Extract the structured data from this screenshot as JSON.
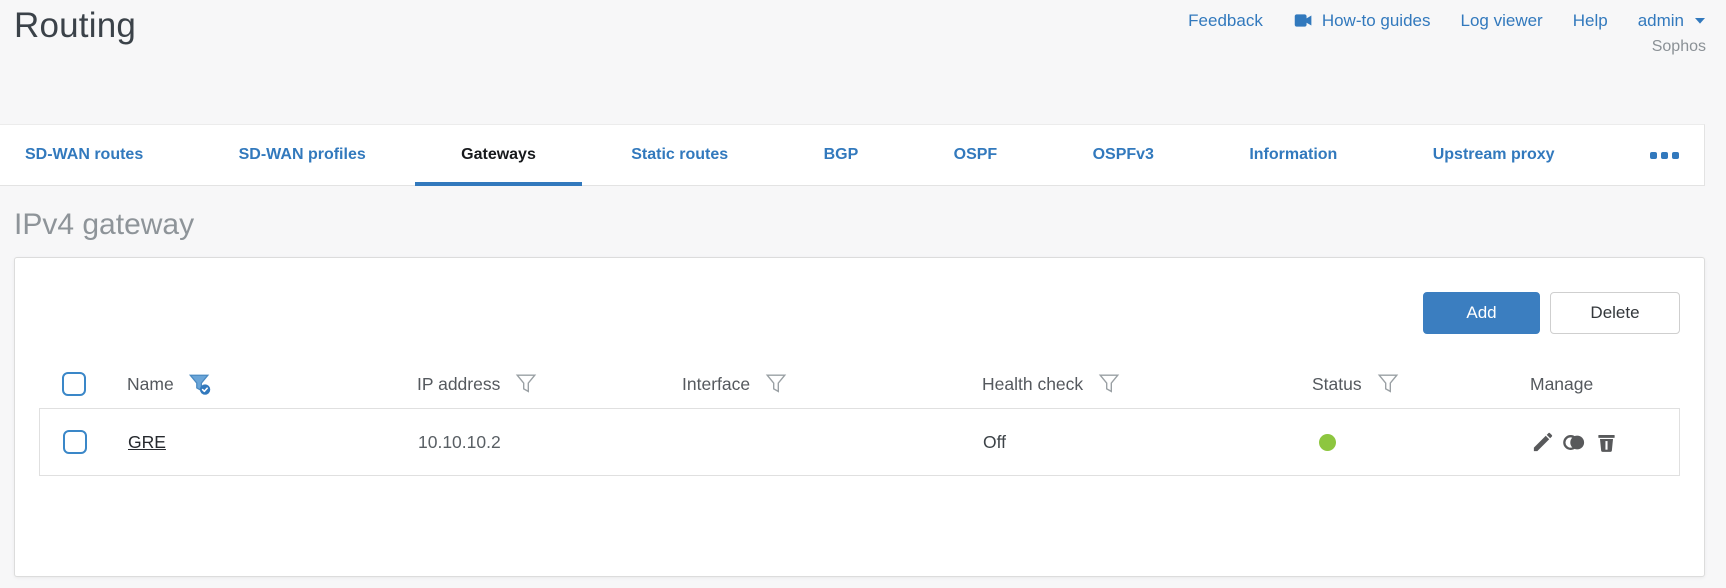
{
  "header": {
    "title": "Routing",
    "links": [
      {
        "label": "Feedback"
      },
      {
        "label": "How-to guides",
        "icon": "video-camera-icon"
      },
      {
        "label": "Log viewer"
      },
      {
        "label": "Help"
      },
      {
        "label": "admin",
        "icon": "caret-down-icon"
      }
    ],
    "account_label": "Sophos"
  },
  "tabs": [
    {
      "label": "SD-WAN routes",
      "active": false
    },
    {
      "label": "SD-WAN profiles",
      "active": false
    },
    {
      "label": "Gateways",
      "active": true
    },
    {
      "label": "Static routes",
      "active": false
    },
    {
      "label": "BGP",
      "active": false
    },
    {
      "label": "OSPF",
      "active": false
    },
    {
      "label": "OSPFv3",
      "active": false
    },
    {
      "label": "Information",
      "active": false
    },
    {
      "label": "Upstream proxy",
      "active": false
    },
    {
      "label": "",
      "icon": "more-tabs-icon"
    }
  ],
  "section": {
    "heading": "IPv4 gateway"
  },
  "toolbar": {
    "add_label": "Add",
    "delete_label": "Delete"
  },
  "table": {
    "columns": [
      {
        "label": "Name",
        "filter": "active"
      },
      {
        "label": "IP address",
        "filter": "inactive"
      },
      {
        "label": "Interface",
        "filter": "inactive"
      },
      {
        "label": "Health check",
        "filter": "inactive"
      },
      {
        "label": "Status",
        "filter": "inactive"
      },
      {
        "label": "Manage",
        "filter": "none"
      }
    ],
    "rows": [
      {
        "name": "GRE",
        "ip_address": "10.10.10.2",
        "interface": "",
        "health_check": "Off",
        "status": "up",
        "manage_actions": [
          "edit",
          "clone",
          "delete"
        ]
      }
    ]
  },
  "colors": {
    "accent_blue": "#3279bd",
    "active_tab_text": "#17191c",
    "status_up_green": "#8dc63f",
    "add_button_bg": "#3b7ec0"
  }
}
